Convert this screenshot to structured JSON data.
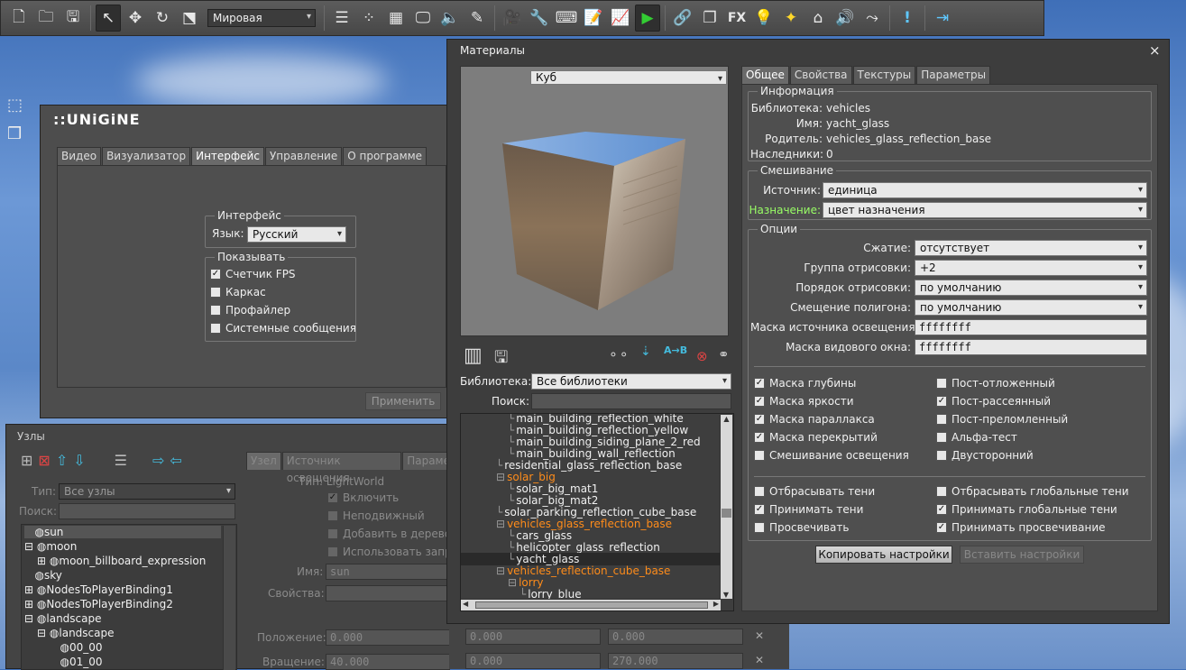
{
  "toolbar": {
    "coord_mode": "Мировая"
  },
  "icons": {
    "unigine_logo": "unigine-logo"
  },
  "unigine": {
    "logo_text": "::UNiGiNE",
    "tabs": [
      "Видео",
      "Визуализатор",
      "Интерфейс",
      "Управление",
      "О программе"
    ],
    "interface_group": "Интерфейс",
    "language_label": "Язык:",
    "language_value": "Русский",
    "show_group": "Показывать",
    "checks": [
      {
        "label": "Счетчик FPS",
        "checked": true
      },
      {
        "label": "Каркас",
        "checked": false
      },
      {
        "label": "Профайлер",
        "checked": false
      },
      {
        "label": "Системные сообщения",
        "checked": false
      }
    ],
    "apply": "Применить"
  },
  "nodes": {
    "title": "Узлы",
    "type_label": "Тип:",
    "type_value": "Все узлы",
    "search_label": "Поиск:",
    "tree": [
      "sun",
      "moon",
      "moon_billboard_expression",
      "sky",
      "NodesToPlayerBinding1",
      "NodesToPlayerBinding2",
      "landscape",
      "landscape",
      "00_00",
      "01_00"
    ],
    "tabs": [
      "Узел",
      "Источник освещения",
      "Параме"
    ],
    "type_text": "Тип: LightWorld",
    "checks": [
      "Включить",
      "Неподвижный",
      "Добавить в дерево",
      "Использовать запр"
    ],
    "name_label": "Имя:",
    "name_value": "sun",
    "props_label": "Свойства:",
    "pos_label": "Положение:",
    "pos": [
      "0.000",
      "0.000",
      "0.000"
    ],
    "rot_label": "Вращение:",
    "rot": [
      "40.000",
      "0.000",
      "270.000"
    ]
  },
  "materials": {
    "title": "Материалы",
    "close": "×",
    "preview_value": "Куб",
    "library_label": "Библиотека:",
    "library_value": "Все библиотеки",
    "search_label": "Поиск:",
    "tree": [
      {
        "text": "main_building_reflection_white",
        "indent": 2,
        "orange": false
      },
      {
        "text": "main_building_reflection_yellow",
        "indent": 2,
        "orange": false
      },
      {
        "text": "main_building_siding_plane_2_red",
        "indent": 2,
        "orange": false
      },
      {
        "text": "main_building_wall_reflection",
        "indent": 2,
        "orange": false
      },
      {
        "text": "residential_glass_reflection_base",
        "indent": 1,
        "orange": false
      },
      {
        "text": "solar_big",
        "indent": 1,
        "orange": true
      },
      {
        "text": "solar_big_mat1",
        "indent": 2,
        "orange": false
      },
      {
        "text": "solar_big_mat2",
        "indent": 2,
        "orange": false
      },
      {
        "text": "solar_parking_reflection_cube_base",
        "indent": 1,
        "orange": false
      },
      {
        "text": "vehicles_glass_reflection_base",
        "indent": 1,
        "orange": true
      },
      {
        "text": "cars_glass",
        "indent": 2,
        "orange": false
      },
      {
        "text": "helicopter_glass_reflection",
        "indent": 2,
        "orange": false
      },
      {
        "text": "yacht_glass",
        "indent": 2,
        "orange": false,
        "selected": true
      },
      {
        "text": "vehicles_reflection_cube_base",
        "indent": 1,
        "orange": true
      },
      {
        "text": "lorry",
        "indent": 2,
        "orange": true
      },
      {
        "text": "lorry_blue",
        "indent": 3,
        "orange": false
      }
    ],
    "tabs": [
      "Общее",
      "Свойства",
      "Текстуры",
      "Параметры"
    ],
    "info_group": "Информация",
    "info": [
      {
        "k": "Библиотека:",
        "v": "vehicles"
      },
      {
        "k": "Имя:",
        "v": "yacht_glass"
      },
      {
        "k": "Родитель:",
        "v": "vehicles_glass_reflection_base"
      },
      {
        "k": "Наследники:",
        "v": "0"
      }
    ],
    "blend_group": "Смешивание",
    "source_label": "Источник:",
    "source_value": "единица",
    "dest_label": "Назначение:",
    "dest_value": "цвет назначения",
    "options_group": "Опции",
    "options": [
      {
        "k": "Сжатие:",
        "v": "отсутствует",
        "combo": true
      },
      {
        "k": "Группа отрисовки:",
        "v": "+2",
        "combo": true
      },
      {
        "k": "Порядок отрисовки:",
        "v": "по умолчанию",
        "combo": true
      },
      {
        "k": "Смещение полигона:",
        "v": "по умолчанию",
        "combo": true
      },
      {
        "k": "Маска источника освещения:",
        "v": "ffffffff",
        "combo": false
      },
      {
        "k": "Маска видового окна:",
        "v": "ffffffff",
        "combo": false
      }
    ],
    "checks_left": [
      {
        "label": "Маска глубины",
        "checked": true
      },
      {
        "label": "Маска яркости",
        "checked": true
      },
      {
        "label": "Маска параллакса",
        "checked": true
      },
      {
        "label": "Маска перекрытий",
        "checked": true
      },
      {
        "label": "Смешивание освещения",
        "checked": false
      }
    ],
    "checks_right": [
      {
        "label": "Пост-отложенный",
        "checked": false
      },
      {
        "label": "Пост-рассеянный",
        "checked": true
      },
      {
        "label": "Пост-преломленный",
        "checked": false
      },
      {
        "label": "Альфа-тест",
        "checked": false
      },
      {
        "label": "Двусторонний",
        "checked": false
      }
    ],
    "shadow_left": [
      {
        "label": "Отбрасывать тени",
        "checked": false
      },
      {
        "label": "Принимать тени",
        "checked": true
      },
      {
        "label": "Просвечивать",
        "checked": false
      }
    ],
    "shadow_right": [
      {
        "label": "Отбрасывать глобальные тени",
        "checked": false
      },
      {
        "label": "Принимать глобальные тени",
        "checked": true
      },
      {
        "label": "Принимать просвечивание",
        "checked": true
      }
    ],
    "copy": "Копировать настройки",
    "paste": "Вставить настройки"
  }
}
